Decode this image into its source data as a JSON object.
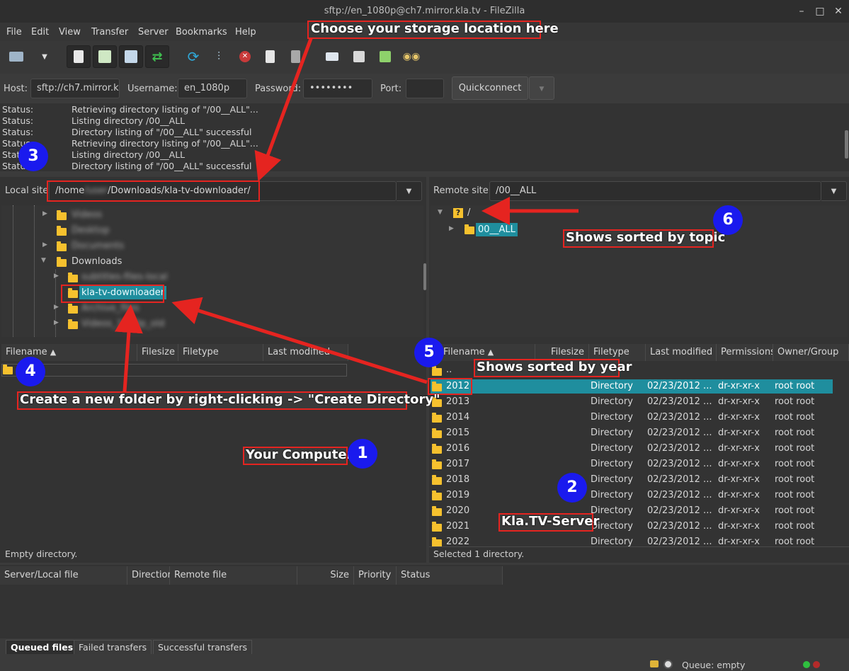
{
  "window": {
    "title": "sftp://en_1080p@ch7.mirror.kla.tv - FileZilla"
  },
  "menu": [
    "File",
    "Edit",
    "View",
    "Transfer",
    "Server",
    "Bookmarks",
    "Help"
  ],
  "quickconnect": {
    "host_label": "Host:",
    "host_value": "sftp://ch7.mirror.k",
    "user_label": "Username:",
    "user_value": "en_1080p",
    "pass_label": "Password:",
    "pass_value": "••••••••",
    "port_label": "Port:",
    "port_value": "",
    "button": "Quickconnect"
  },
  "log": [
    {
      "label": "Status:",
      "msg": "Retrieving directory listing of \"/00__ALL\"..."
    },
    {
      "label": "Status:",
      "msg": "Listing directory /00__ALL"
    },
    {
      "label": "Status:",
      "msg": "Directory listing of \"/00__ALL\" successful"
    },
    {
      "label": "Status:",
      "msg": "Retrieving directory listing of \"/00__ALL\"..."
    },
    {
      "label": "Status:",
      "msg": "Listing directory /00__ALL"
    },
    {
      "label": "Status:",
      "msg": "Directory listing of \"/00__ALL\" successful"
    }
  ],
  "local": {
    "label": "Local site:",
    "path_start": "/home",
    "path_hidden": "/user",
    "path_end": "/Downloads/kla-tv-downloader/",
    "tree": [
      "Videos",
      "Desktop",
      "Documents",
      "Downloads",
      "subtitles-files-local",
      "kla-tv-downloader",
      "Archive_files",
      "Videos_1080p_old"
    ],
    "columns": [
      "Filename",
      "Filesize",
      "Filetype",
      "Last modified"
    ],
    "parent_row": "..",
    "status": "Empty directory."
  },
  "remote": {
    "label": "Remote site:",
    "path": "/00__ALL",
    "tree_root": "/",
    "tree_child": "00__ALL",
    "columns": [
      "Filename",
      "Filesize",
      "Filetype",
      "Last modified",
      "Permissions",
      "Owner/Group"
    ],
    "parent_row": "..",
    "rows": [
      {
        "name": "2012",
        "type": "Directory",
        "modified": "02/23/2012 ...",
        "perms": "dr-xr-xr-x",
        "owner": "root root"
      },
      {
        "name": "2013",
        "type": "Directory",
        "modified": "02/23/2012 ...",
        "perms": "dr-xr-xr-x",
        "owner": "root root"
      },
      {
        "name": "2014",
        "type": "Directory",
        "modified": "02/23/2012 ...",
        "perms": "dr-xr-xr-x",
        "owner": "root root"
      },
      {
        "name": "2015",
        "type": "Directory",
        "modified": "02/23/2012 ...",
        "perms": "dr-xr-xr-x",
        "owner": "root root"
      },
      {
        "name": "2016",
        "type": "Directory",
        "modified": "02/23/2012 ...",
        "perms": "dr-xr-xr-x",
        "owner": "root root"
      },
      {
        "name": "2017",
        "type": "Directory",
        "modified": "02/23/2012 ...",
        "perms": "dr-xr-xr-x",
        "owner": "root root"
      },
      {
        "name": "2018",
        "type": "Directory",
        "modified": "02/23/2012 ...",
        "perms": "dr-xr-xr-x",
        "owner": "root root"
      },
      {
        "name": "2019",
        "type": "Directory",
        "modified": "02/23/2012 ...",
        "perms": "dr-xr-xr-x",
        "owner": "root root"
      },
      {
        "name": "2020",
        "type": "Directory",
        "modified": "02/23/2012 ...",
        "perms": "dr-xr-xr-x",
        "owner": "root root"
      },
      {
        "name": "2021",
        "type": "Directory",
        "modified": "02/23/2012 ...",
        "perms": "dr-xr-xr-x",
        "owner": "root root"
      },
      {
        "name": "2022",
        "type": "Directory",
        "modified": "02/23/2012 ...",
        "perms": "dr-xr-xr-x",
        "owner": "root root"
      }
    ],
    "status": "Selected 1 directory."
  },
  "queue": {
    "columns": [
      "Server/Local file",
      "Direction",
      "Remote file",
      "Size",
      "Priority",
      "Status"
    ],
    "tabs": [
      "Queued files",
      "Failed transfers",
      "Successful transfers"
    ],
    "status": "Queue: empty"
  },
  "annotations": {
    "storage": "Choose your storage location here",
    "topic": "Shows sorted by topic",
    "year": "Shows sorted by year",
    "create_dir": "Create a new folder by right-clicking -> \"Create Directory\"",
    "computer": "Your Computer",
    "server": "Kla.TV-Server",
    "badges": [
      "1",
      "2",
      "3",
      "4",
      "5",
      "6"
    ]
  },
  "colors": {
    "accent_red": "#e52420",
    "badge_blue": "#1a1aee",
    "selection": "#1f8e9e",
    "folder": "#f6c12e"
  }
}
